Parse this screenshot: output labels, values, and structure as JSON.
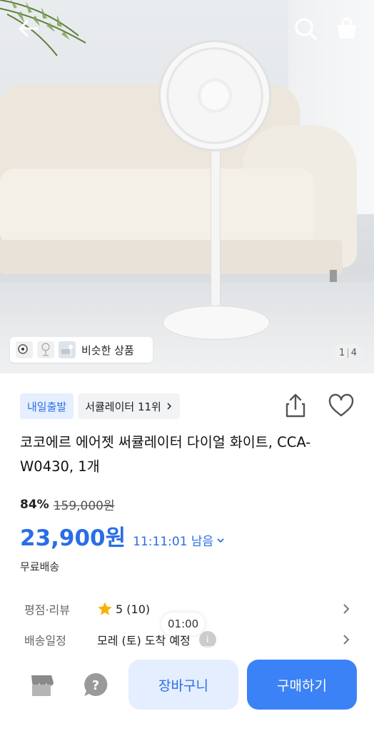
{
  "hero": {
    "similar_label": "비슷한 상품",
    "counter_current": "1",
    "counter_total": "4"
  },
  "badges": {
    "delivery": "내일출발",
    "ranking": "서큘레이터 11위"
  },
  "product": {
    "title": "코코에르 에어젯 써큘레이터 다이얼 화이트, CCA-W0430, 1개",
    "discount": "84%",
    "original_price": "159,000원",
    "price": "23,900원",
    "timer": "11:11:01 남음",
    "shipping": "무료배송"
  },
  "details": {
    "rating_label": "평점·리뷰",
    "rating_value": "5 (10)",
    "delivery_label": "배송일정",
    "delivery_value": "모레 (토) 도착 예정"
  },
  "toast": "01:00",
  "actions": {
    "cart": "장바구니",
    "buy": "구매하기"
  },
  "colors": {
    "accent": "#2a6de6",
    "buy_button": "#3b82f6",
    "cart_button": "#e4eefe",
    "star": "#f5b301"
  },
  "icons": [
    "back-arrow-icon",
    "search-icon",
    "shopping-bag-icon",
    "share-icon",
    "heart-icon",
    "star-icon",
    "chevron-right-icon",
    "chevron-down-icon",
    "info-icon",
    "store-icon",
    "help-icon"
  ]
}
